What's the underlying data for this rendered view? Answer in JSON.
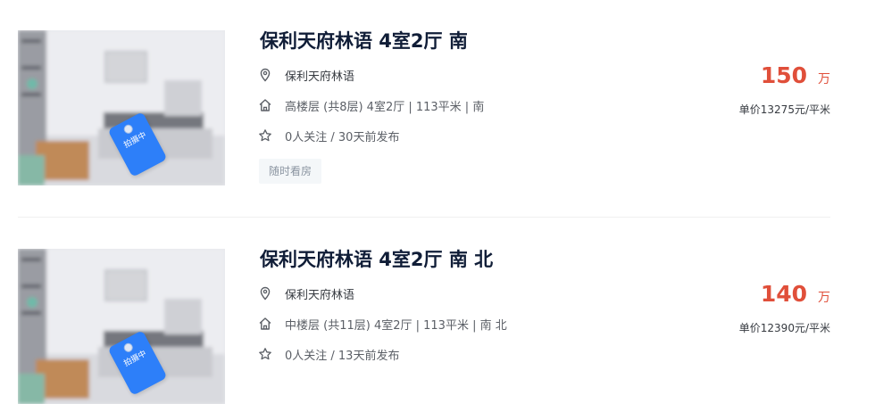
{
  "listings": [
    {
      "title": "保利天府林语 4室2厅 南",
      "community": "保利天府林语",
      "house_info": "高楼层 (共8层) 4室2厅 | 113平米 | 南",
      "follow_info": "0人关注 / 30天前发布",
      "tag": "随时看房",
      "photo_badge": "拍摄中",
      "total_price": "150",
      "price_unit": "万",
      "unit_price": "单价13275元/平米"
    },
    {
      "title": "保利天府林语 4室2厅 南 北",
      "community": "保利天府林语",
      "house_info": "中楼层 (共11层) 4室2厅 | 113平米 | 南 北",
      "follow_info": "0人关注 / 13天前发布",
      "photo_badge": "拍摄中",
      "total_price": "140",
      "price_unit": "万",
      "unit_price": "单价12390元/平米"
    }
  ],
  "icons": {
    "location": "location-pin-icon",
    "house": "house-icon",
    "follow": "star-icon"
  },
  "colors": {
    "price": "#e04f3a",
    "title": "#101d37",
    "badge": "#2d7ff9",
    "tag_bg": "#f4f7f9"
  }
}
